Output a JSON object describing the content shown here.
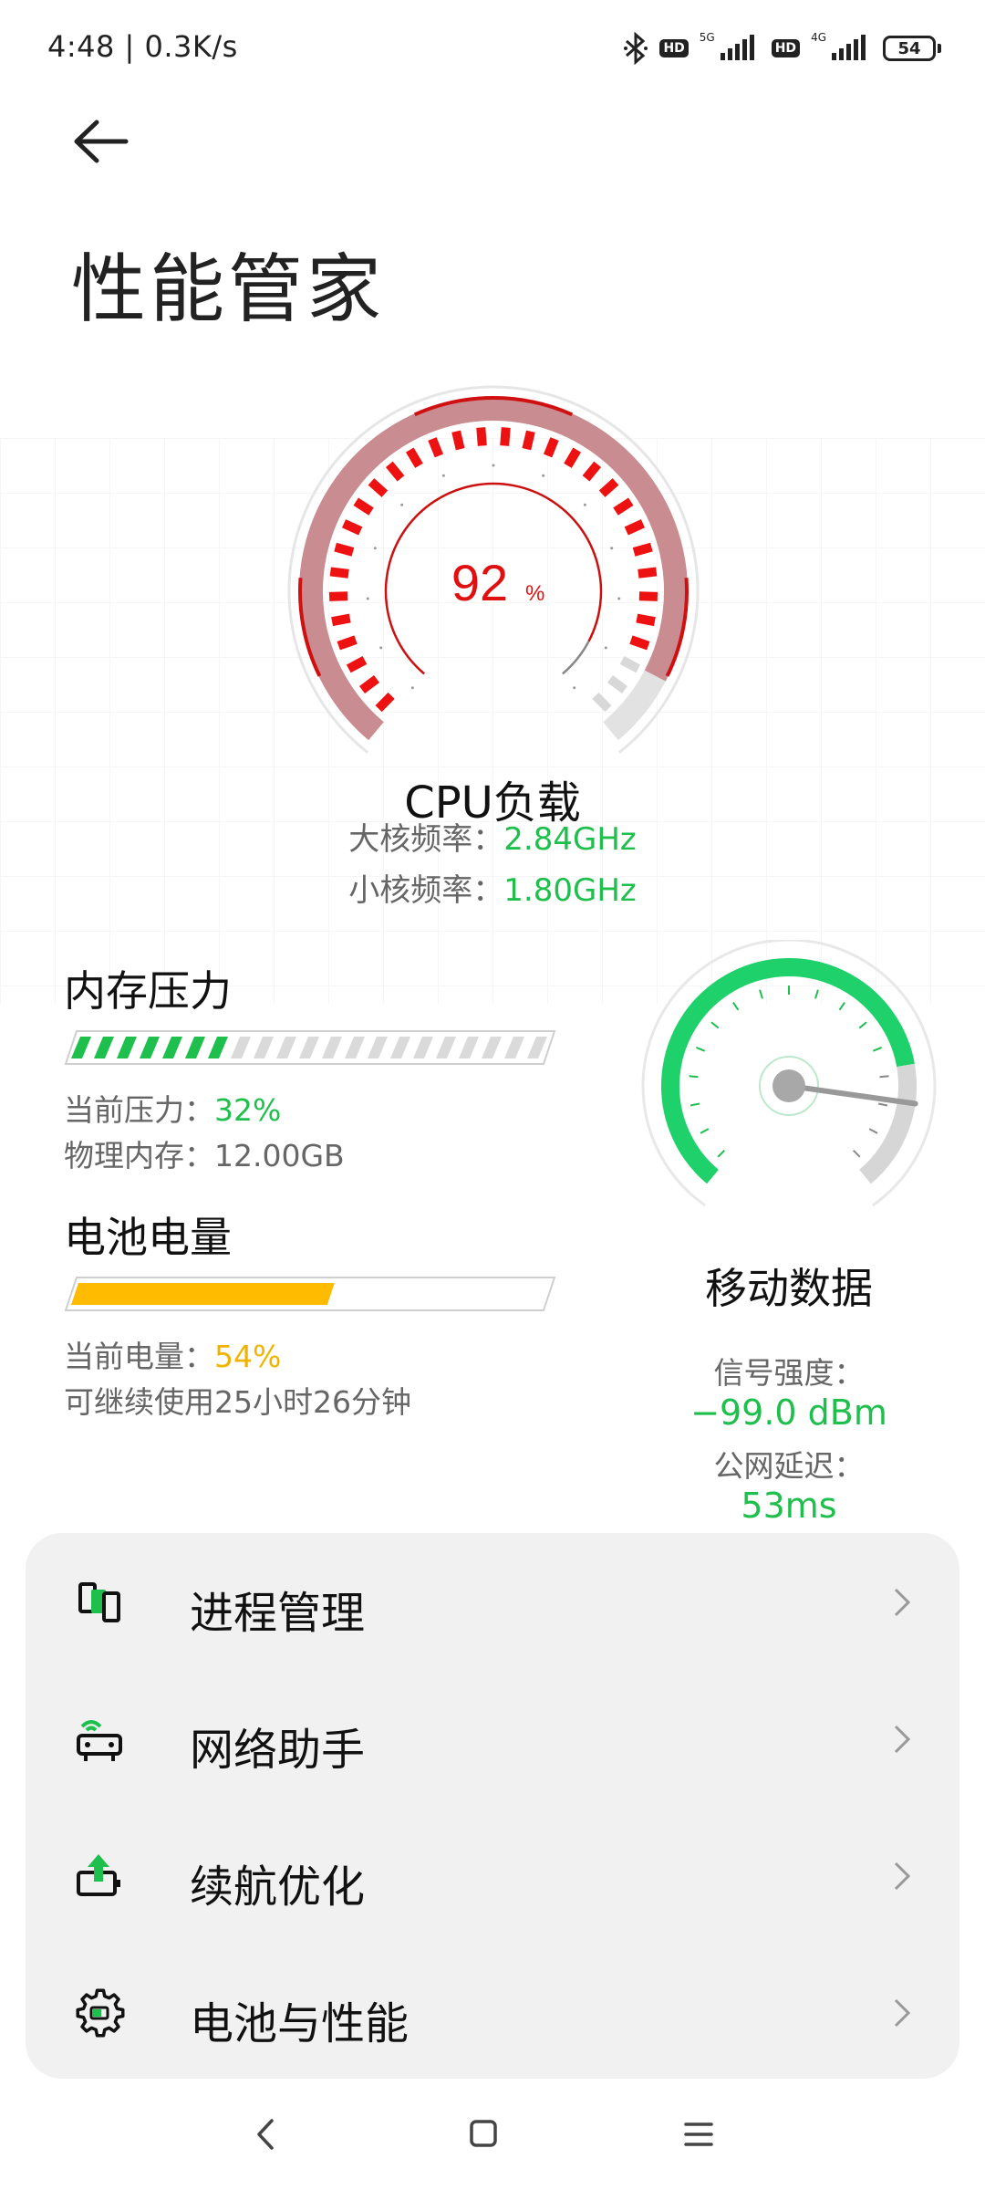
{
  "status_bar": {
    "time_speed": "4:48 | 0.3K/s",
    "hd_badge_1": "HD",
    "network_1": "5G",
    "hd_badge_2": "HD",
    "network_2": "4G",
    "battery_level": "54"
  },
  "header": {
    "title": "性能管家"
  },
  "cpu": {
    "load_value": "92",
    "load_unit": "%",
    "title": "CPU负载",
    "big_core_label": "大核频率：",
    "big_core_value": "2.84GHz",
    "small_core_label": "小核频率：",
    "small_core_value": "1.80GHz",
    "load_fraction": 0.92
  },
  "memory": {
    "title": "内存压力",
    "pressure_label": "当前压力：",
    "pressure_value": "32%",
    "physical_label": "物理内存：",
    "physical_value": "12.00GB",
    "pressure_fraction": 0.32
  },
  "battery": {
    "title": "电池电量",
    "level_label": "当前电量：",
    "level_value": "54%",
    "remaining_text": "可继续使用25小时26分钟",
    "level_fraction": 0.54
  },
  "mobile_data": {
    "title": "移动数据",
    "signal_label": "信号强度：",
    "signal_value": "−99.0 dBm",
    "latency_label": "公网延迟：",
    "latency_value": "53ms"
  },
  "menu": {
    "items": [
      {
        "label": "进程管理",
        "icon": "process-icon"
      },
      {
        "label": "网络助手",
        "icon": "router-icon"
      },
      {
        "label": "续航优化",
        "icon": "battery-boost-icon"
      },
      {
        "label": "电池与性能",
        "icon": "gear-battery-icon"
      }
    ]
  },
  "colors": {
    "accent_green": "#1fbf4e",
    "cpu_red": "#e01010",
    "battery_yellow": "#ffbb00"
  }
}
